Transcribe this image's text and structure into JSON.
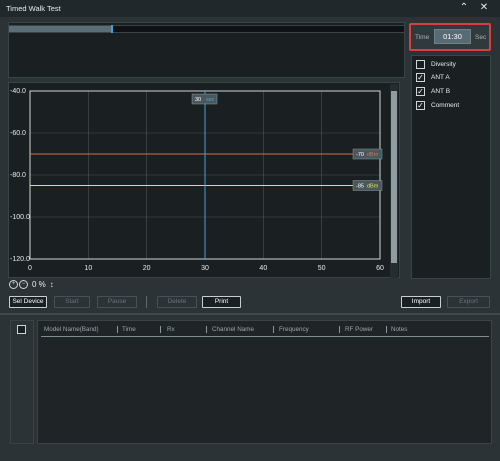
{
  "window": {
    "title": "Timed Walk Test",
    "collapse_glyph": "⌃",
    "close_glyph": "✕"
  },
  "progress": {
    "fraction": 0.26
  },
  "time": {
    "label": "Time",
    "value": "01:30",
    "unit": "Sec"
  },
  "options": [
    {
      "label": "Diversity",
      "checked": false,
      "mark": ""
    },
    {
      "label": "ANT A",
      "checked": true,
      "mark": "✓"
    },
    {
      "label": "ANT B",
      "checked": true,
      "mark": "✓"
    },
    {
      "label": "Comment",
      "checked": true,
      "mark": "✓"
    }
  ],
  "chart_data": {
    "type": "line",
    "x_ticks": [
      "0",
      "10",
      "20",
      "30",
      "40",
      "50",
      "60"
    ],
    "y_ticks": [
      "-40.0",
      "-60.0",
      "-80.0",
      "-100.0",
      "-120.0"
    ],
    "xlim": [
      0,
      60
    ],
    "ylim": [
      -120,
      -40
    ],
    "grid": true,
    "cursor": {
      "x": 30,
      "label": "30",
      "unit": "sec"
    },
    "series": [
      {
        "value": -70,
        "label": "-70",
        "unit": "dBm",
        "color": "#e06a55"
      },
      {
        "value": -85,
        "label": "-85",
        "unit": "dBm",
        "color": "#e8e05a"
      }
    ],
    "colors": {
      "bg": "#1a1f21",
      "grid": "#4a5558",
      "frame": "#cfd6d9",
      "cursor": "#4aa0d0",
      "tick": "#e8ecee"
    }
  },
  "zoom": {
    "zoom_in": "+",
    "zoom_out": "−",
    "value": "0 %",
    "fit_icon": "↕"
  },
  "toolbar": {
    "sel_device": "Sel Device",
    "start": "Start",
    "pause": "Pause",
    "delete": "Delete",
    "print": "Print",
    "import": "Import",
    "export": "Export"
  },
  "table": {
    "columns": [
      "Model Name(Band)",
      "Time",
      "Rx",
      "Channel Name",
      "Frequency",
      "RF Power",
      "Notes"
    ],
    "rows": []
  }
}
